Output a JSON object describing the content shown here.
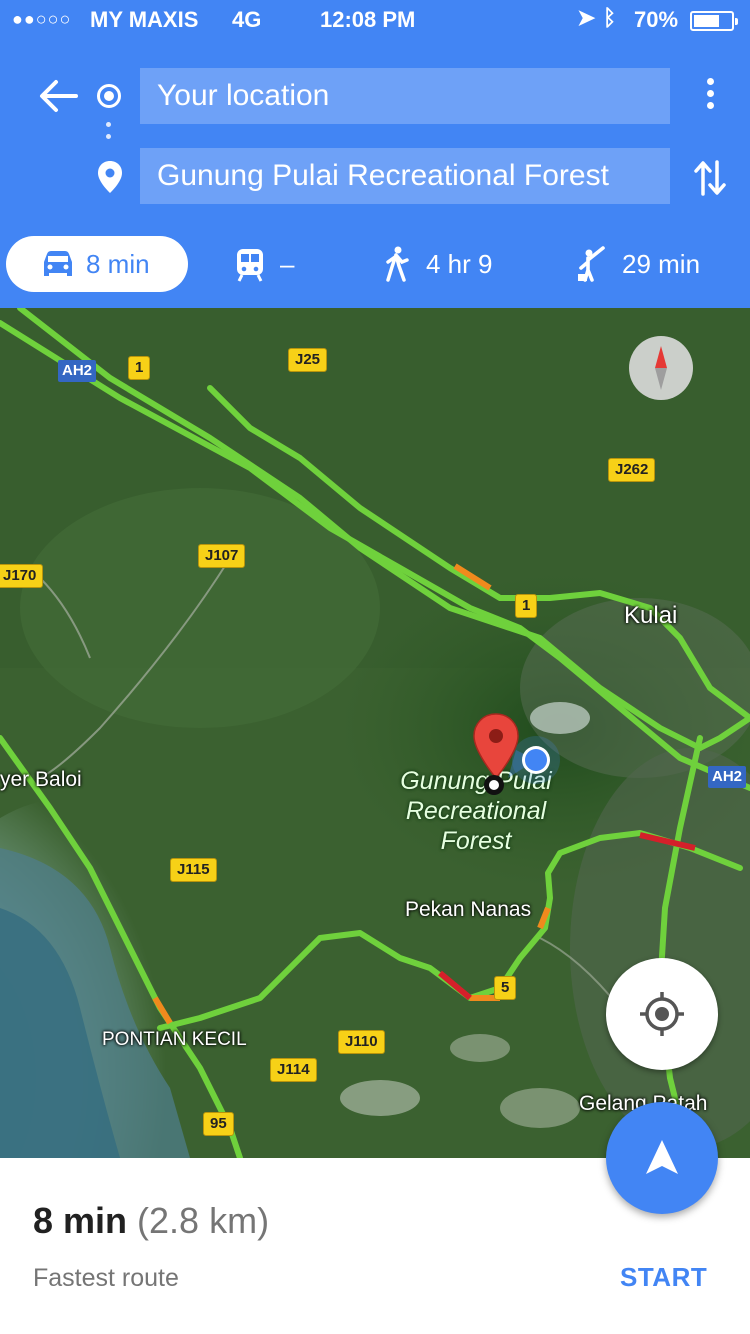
{
  "status_bar": {
    "signal_dots": "●●○○○",
    "carrier": "MY MAXIS",
    "network": "4G",
    "time": "12:08 PM",
    "battery_percent": "70%",
    "battery_level": 0.7
  },
  "directions": {
    "origin": "Your location",
    "destination": "Gunung Pulai Recreational Forest"
  },
  "modes": [
    {
      "name": "drive",
      "label": "8 min",
      "active": true
    },
    {
      "name": "transit",
      "label": "–"
    },
    {
      "name": "walk",
      "label": "4 hr 9"
    },
    {
      "name": "ride-hailing",
      "label": "29 min"
    }
  ],
  "map": {
    "road_shields": [
      "AH2",
      "1",
      "J25",
      "J262",
      "J107",
      "J170",
      "1",
      "AH2",
      "J115",
      "5",
      "J110",
      "J114",
      "95"
    ],
    "places": [
      "Kulai",
      "yer Baloi",
      "Pekan Nanas",
      "PONTIAN KECIL",
      "Gelang Patah"
    ],
    "poi_name": [
      "Gunung Pulai",
      "Recreational",
      "Forest"
    ]
  },
  "summary": {
    "duration": "8 min",
    "distance": "(2.8 km)",
    "note": "Fastest route",
    "start_label": "START"
  },
  "colors": {
    "brand_blue": "#4285f4",
    "route_green": "#6fd13c",
    "traffic_orange": "#f08a1d",
    "traffic_red": "#d4202a"
  }
}
